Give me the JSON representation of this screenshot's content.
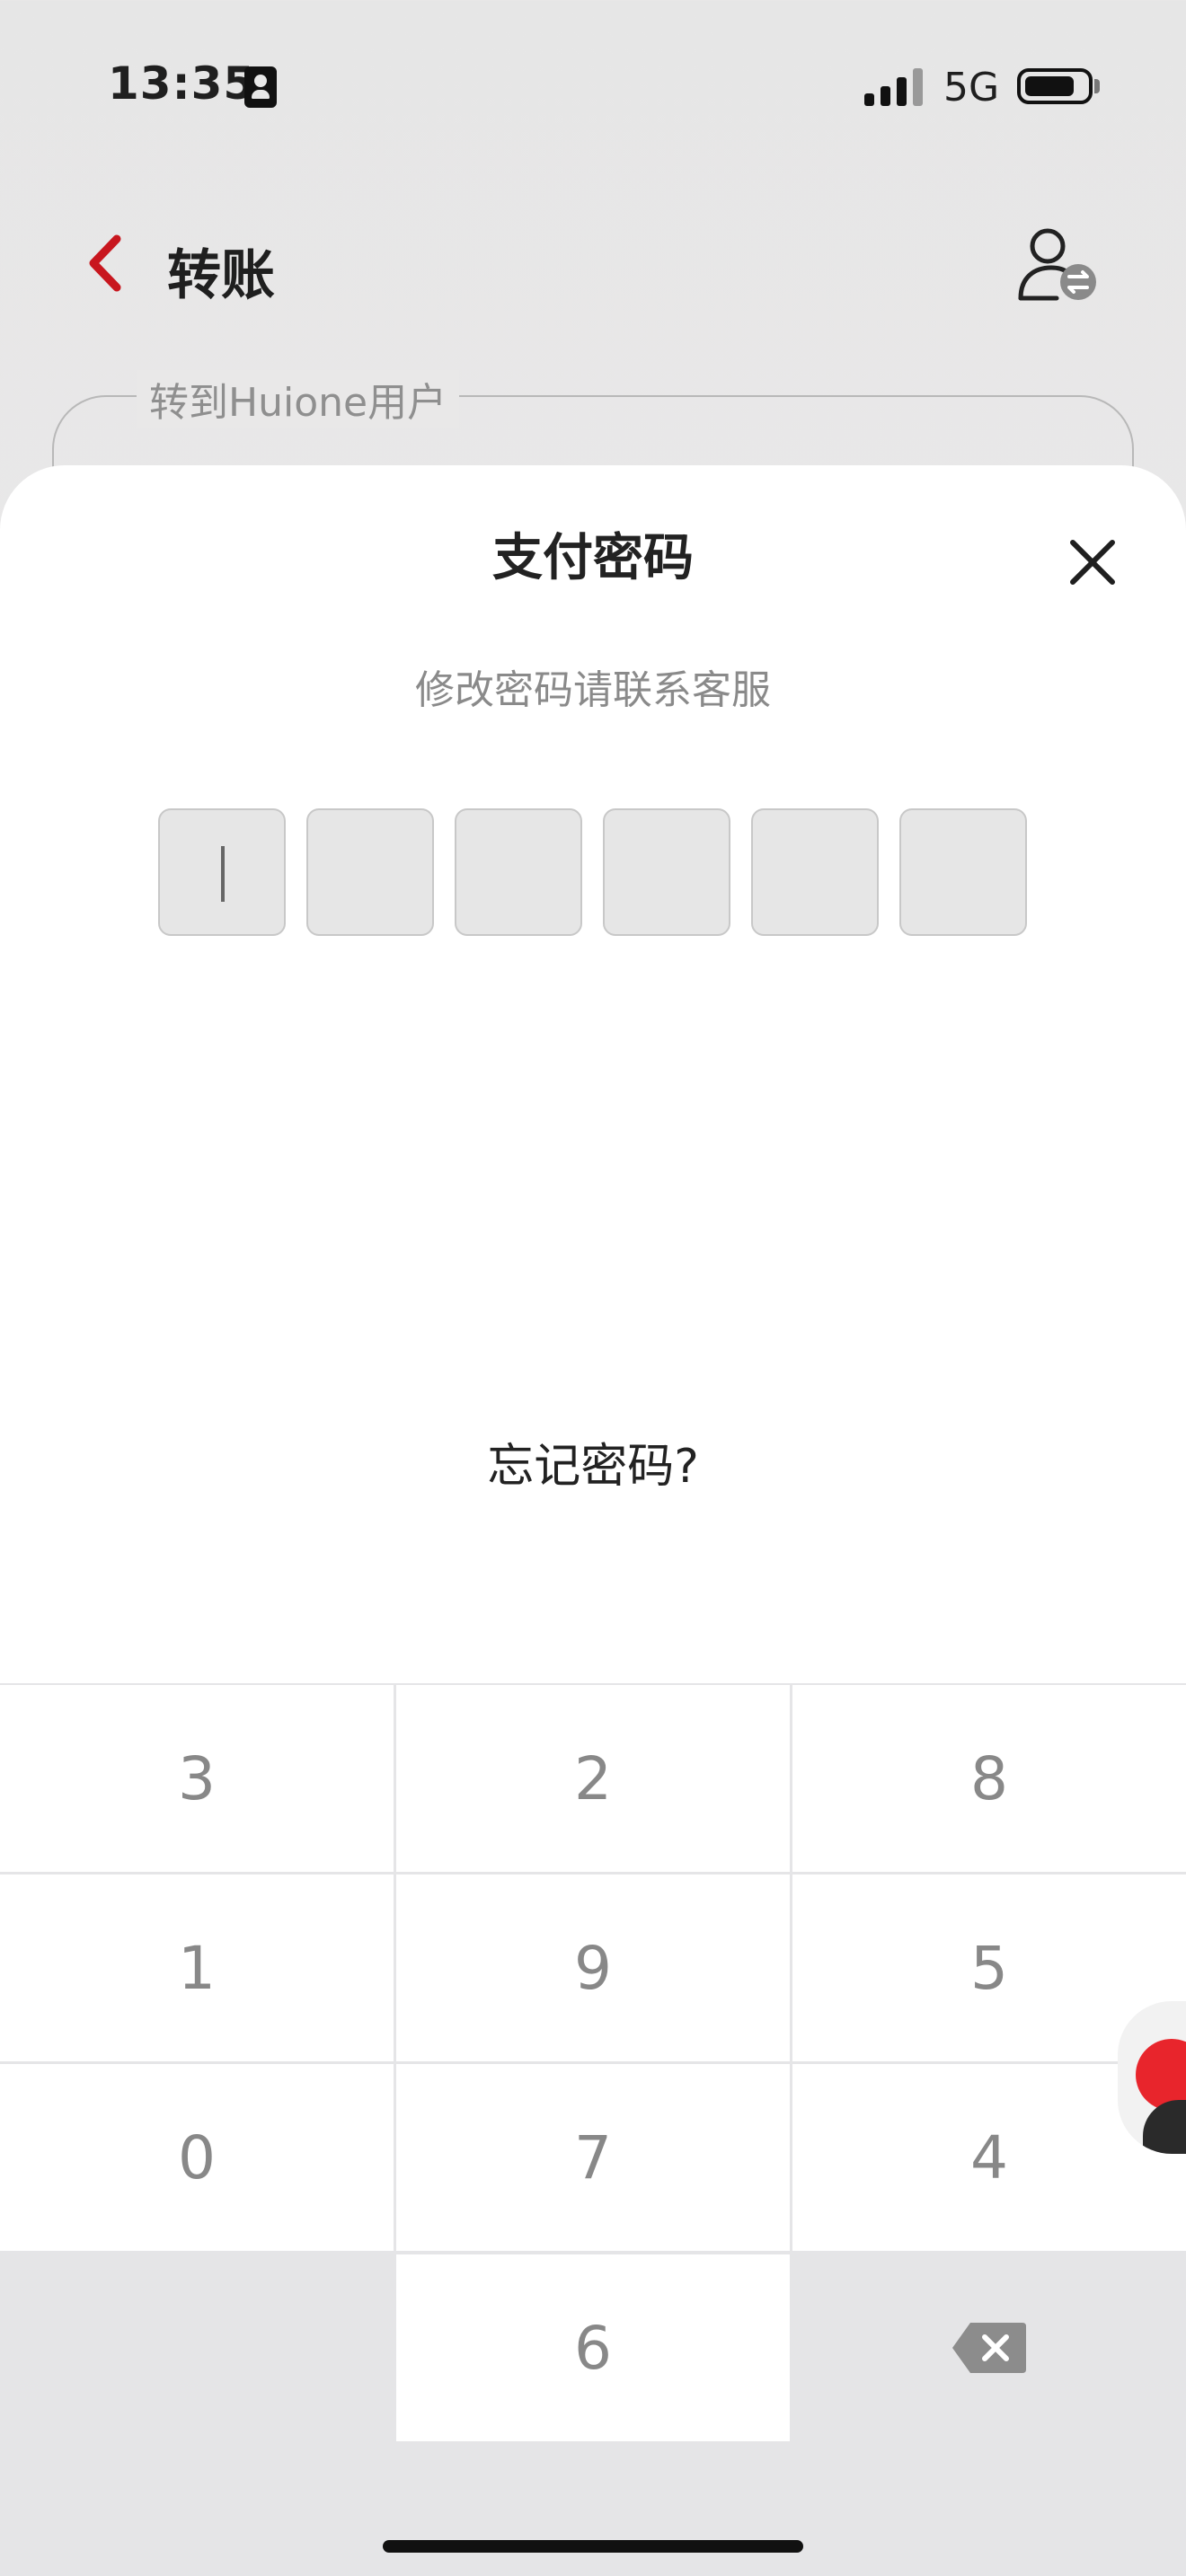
{
  "status_bar": {
    "time": "13:35",
    "network": "5G"
  },
  "header": {
    "title": "转账",
    "back_icon": "chevron-left-icon",
    "action_icon": "user-transfer-icon"
  },
  "recipient": {
    "label": "转到Huione用户"
  },
  "sheet": {
    "title": "支付密码",
    "hint": "修改密码请联系客服",
    "pin_length": 6,
    "filled": 0,
    "forgot_label": "忘记密码?"
  },
  "keypad": {
    "rows": [
      [
        "3",
        "2",
        "8"
      ],
      [
        "1",
        "9",
        "5"
      ],
      [
        "0",
        "7",
        "4"
      ],
      [
        "",
        "6",
        "delete"
      ]
    ]
  },
  "colors": {
    "accent": "#c8161e",
    "pin_box": "#e6e6e6",
    "keypad_bg": "#e5e5e7"
  }
}
